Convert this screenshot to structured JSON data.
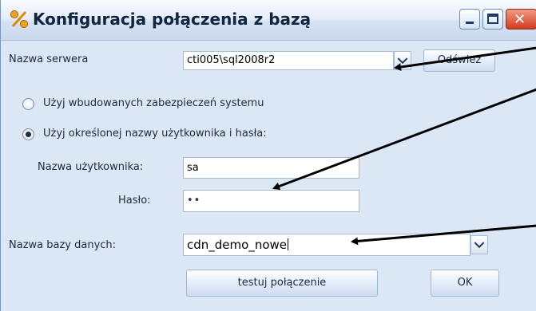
{
  "window": {
    "title": "Konfiguracja połączenia z bazą",
    "minimize": "",
    "maximize": "",
    "close": "✕"
  },
  "server": {
    "label": "Nazwa serwera",
    "value": "cti005\\sql2008r2",
    "refresh_label": "Odśwież"
  },
  "auth": {
    "windows_label": "Użyj wbudowanych zabezpieczeń systemu",
    "windows_selected": false,
    "sql_label": "Użyj określonej nazwy użytkownika i hasła:",
    "sql_selected": true
  },
  "user": {
    "label": "Nazwa użytkownika:",
    "value": "sa"
  },
  "password": {
    "label": "Hasło:",
    "value": "••"
  },
  "database": {
    "label": "Nazwa bazy danych:",
    "value": "cdn_demo_nowe"
  },
  "buttons": {
    "test_label": "testuj połączenie",
    "ok_label": "OK"
  },
  "colors": {
    "background": "#dce7f5",
    "titlebar": "#d5e1f2",
    "close_button": "#d23b1e",
    "annotation_arrow": "#000000"
  },
  "icons": [
    "percent-icon",
    "minimize-icon",
    "maximize-icon",
    "close-icon",
    "chevron-down-icon",
    "arrow-annotation-icon"
  ]
}
